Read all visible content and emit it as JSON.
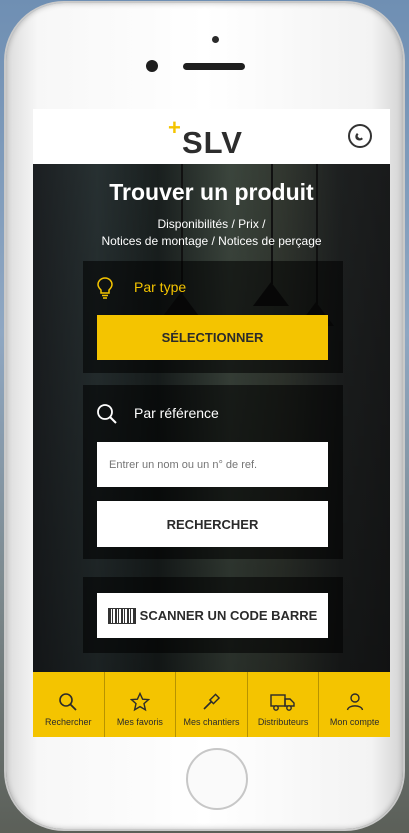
{
  "header": {
    "logo_text": "SLV"
  },
  "hero": {
    "title": "Trouver un produit",
    "subtitle_line1": "Disponibilités / Prix /",
    "subtitle_line2": "Notices de montage / Notices de perçage"
  },
  "by_type": {
    "label": "Par type",
    "button_label": "SÉLECTIONNER"
  },
  "by_reference": {
    "label": "Par référence",
    "input_placeholder": "Entrer un nom ou un n° de ref.",
    "input_value": "",
    "button_label": "RECHERCHER"
  },
  "scan": {
    "button_label": "SCANNER UN CODE BARRE"
  },
  "tabbar": {
    "items": [
      {
        "label": "Rechercher",
        "icon": "search-icon"
      },
      {
        "label": "Mes favoris",
        "icon": "star-icon"
      },
      {
        "label": "Mes chantiers",
        "icon": "screwdriver-icon"
      },
      {
        "label": "Distributeurs",
        "icon": "truck-icon"
      },
      {
        "label": "Mon compte",
        "icon": "user-icon"
      }
    ]
  },
  "colors": {
    "accent": "#f4c400",
    "text_dark": "#2b2b2b",
    "header_bg": "#ffffff"
  }
}
